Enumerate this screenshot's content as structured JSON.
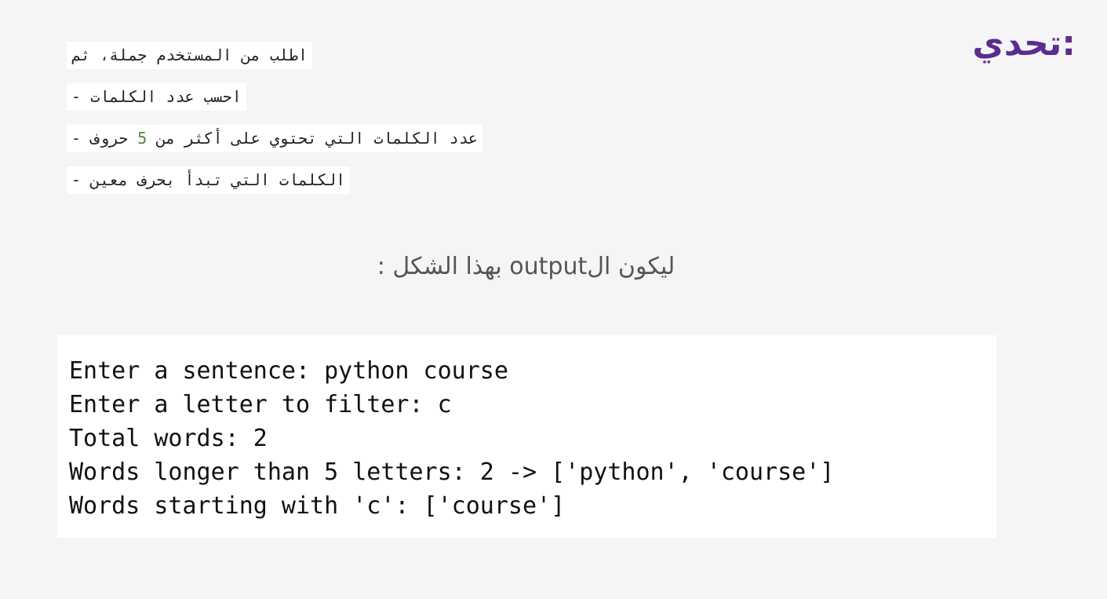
{
  "title": "تحدي:",
  "task": {
    "line1": "اطلب من المستخدم جملة، ثم",
    "line2": "احسب عدد الكلمات -",
    "line3_before": "عدد الكلمات التي تحتوي على أكثر من ",
    "line3_number": "5",
    "line3_after": " حروف -",
    "line4": "الكلمات التي تبدأ بحرف معين -"
  },
  "output_caption": "ليكون الoutput بهذا الشكل :",
  "output_lines": [
    "Enter a sentence: python course",
    "Enter a letter to filter: c",
    "Total words: 2",
    "Words longer than 5 letters: 2 -> ['python', 'course']",
    "Words starting with 'c': ['course']"
  ]
}
